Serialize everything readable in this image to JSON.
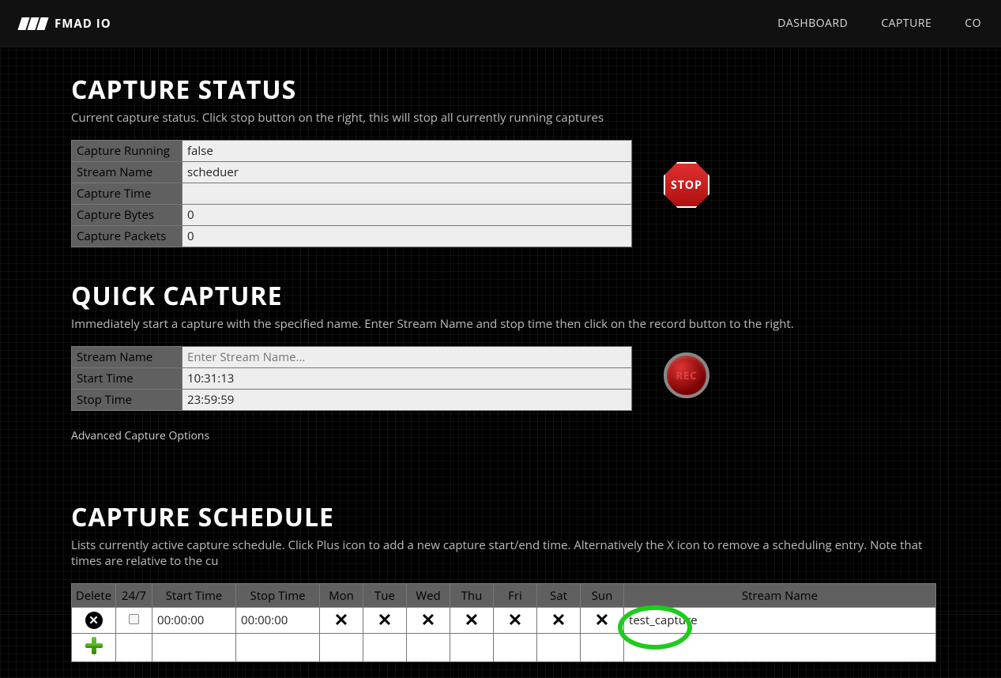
{
  "nav": {
    "brand": "FMAD IO",
    "links": [
      "DASHBOARD",
      "CAPTURE",
      "CO"
    ]
  },
  "status": {
    "title": "CAPTURE STATUS",
    "subtitle": "Current capture status. Click stop button on the right, this will stop all currently running captures",
    "rows": {
      "cap_running_label": "Capture Running",
      "cap_running_val": "false",
      "stream_name_label": "Stream Name",
      "stream_name_val": "scheduer",
      "cap_time_label": "Capture Time",
      "cap_time_val": "",
      "cap_bytes_label": "Capture Bytes",
      "cap_bytes_val": "0",
      "cap_packets_label": "Capture Packets",
      "cap_packets_val": "0"
    },
    "stop_label": "STOP"
  },
  "quick": {
    "title": "QUICK CAPTURE",
    "subtitle": "Immediately start a capture with the specified name. Enter Stream Name and stop time then click on the record button to the right.",
    "rows": {
      "stream_name_label": "Stream Name",
      "stream_name_placeholder": "Enter Stream Name...",
      "start_time_label": "Start Time",
      "start_time_val": "10:31:13",
      "stop_time_label": "Stop Time",
      "stop_time_val": "23:59:59"
    },
    "rec_label": "REC",
    "advanced_link": "Advanced Capture Options"
  },
  "schedule": {
    "title": "CAPTURE SCHEDULE",
    "subtitle": "Lists currently active capture schedule. Click Plus icon to add a new capture start/end time. Alternatively the X icon to remove a scheduling entry. Note that times are relative to the cu",
    "cols": {
      "del": "Delete",
      "all": "24/7",
      "start": "Start Time",
      "stop": "Stop Time",
      "mon": "Mon",
      "tue": "Tue",
      "wed": "Wed",
      "thu": "Thu",
      "fri": "Fri",
      "sat": "Sat",
      "sun": "Sun",
      "sn": "Stream Name"
    },
    "row0": {
      "start": "00:00:00",
      "stop": "00:00:00",
      "stream": "test_capture"
    }
  }
}
